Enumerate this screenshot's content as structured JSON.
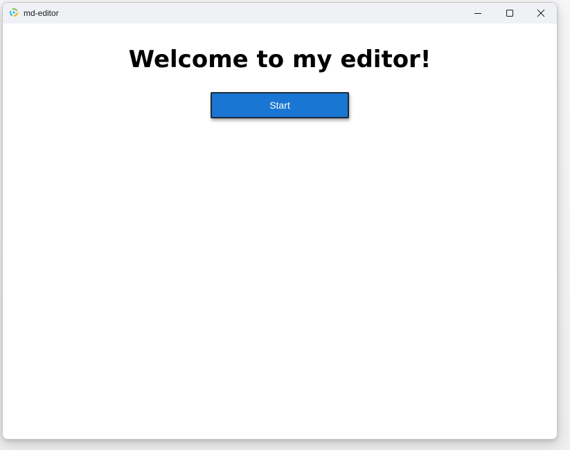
{
  "window": {
    "title": "md-editor",
    "icon": "app-logo-icon",
    "controls": {
      "minimize_icon": "minimize-icon",
      "maximize_icon": "maximize-icon",
      "close_icon": "close-icon"
    }
  },
  "main": {
    "heading": "Welcome to my editor!",
    "start_button_label": "Start"
  },
  "colors": {
    "titlebar": "#eff1f5",
    "button": "#1976d2",
    "button_border": "#1f2937",
    "button_text": "#ffffff"
  }
}
